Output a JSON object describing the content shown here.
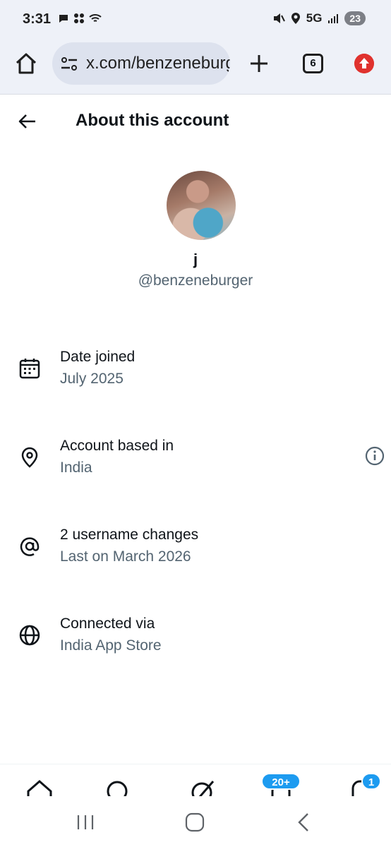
{
  "status": {
    "time": "3:31",
    "network": "5G",
    "battery": "23"
  },
  "browser": {
    "url": "x.com/benzeneburger",
    "tab_count": "6"
  },
  "header": {
    "title": "About this account"
  },
  "profile": {
    "name": "j",
    "handle": "@benzeneburger"
  },
  "rows": [
    {
      "title": "Date joined",
      "value": "July 2025",
      "icon": "calendar-icon"
    },
    {
      "title": "Account based in",
      "value": "India",
      "icon": "location-pin-icon"
    },
    {
      "title": "2 username changes",
      "value": "Last on March 2026",
      "icon": "at-sign-icon"
    },
    {
      "title": "Connected via",
      "value": "India App Store",
      "icon": "globe-icon"
    }
  ],
  "nav": {
    "badge_notifications": "20+",
    "badge_messages": "1"
  },
  "colors": {
    "accent": "#1d9bf0",
    "secondary_text": "#536471",
    "update_red": "#e0322e"
  }
}
